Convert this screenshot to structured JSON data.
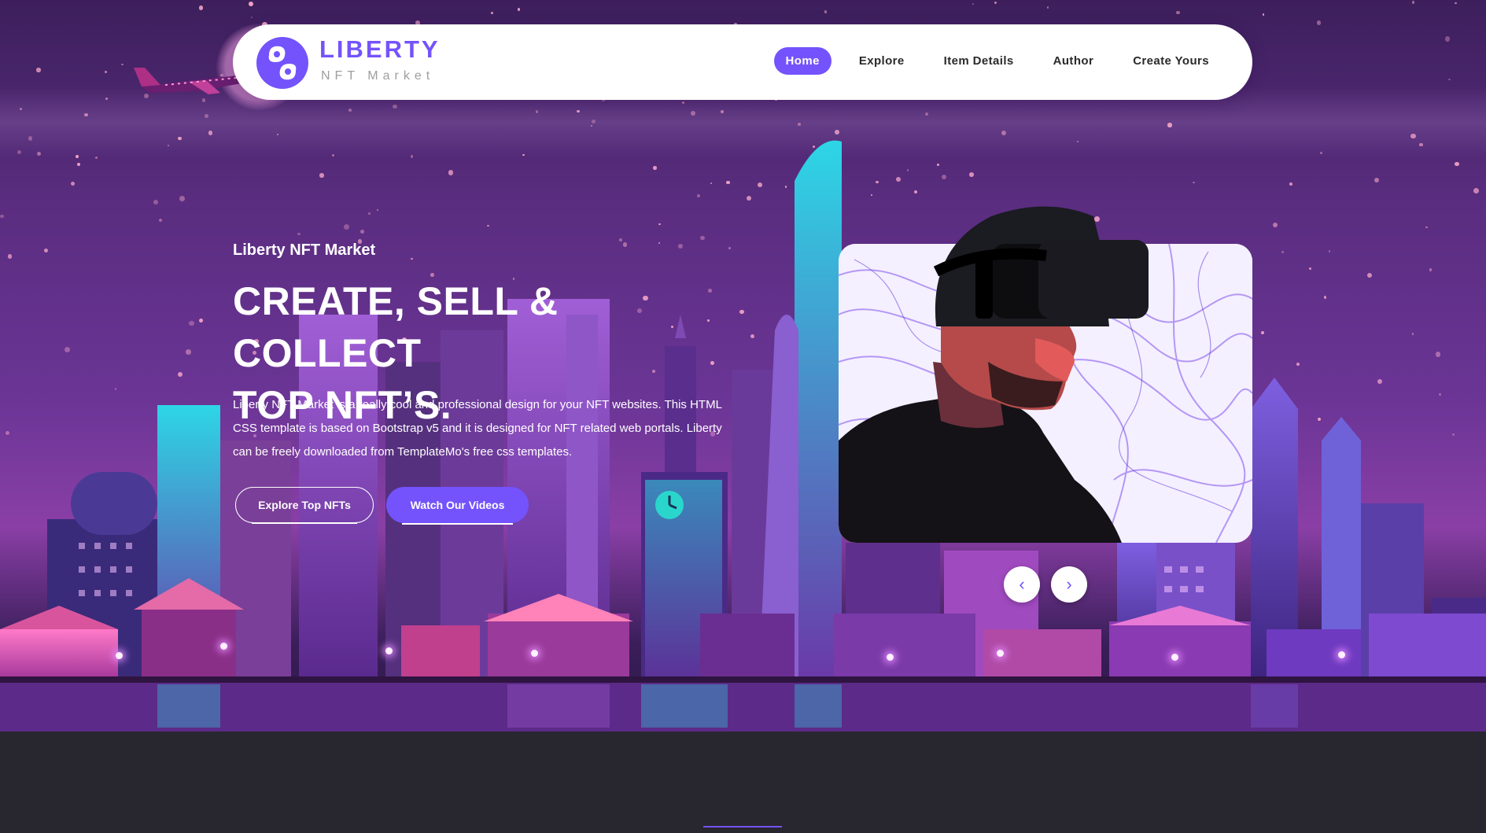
{
  "brand": {
    "title": "LIBERTY",
    "subtitle": "NFT Market",
    "accent": "#7453fc"
  },
  "nav": {
    "items": [
      {
        "label": "Home",
        "active": true
      },
      {
        "label": "Explore",
        "active": false
      },
      {
        "label": "Item Details",
        "active": false
      },
      {
        "label": "Author",
        "active": false
      },
      {
        "label": "Create Yours",
        "active": false
      }
    ]
  },
  "hero": {
    "kicker": "Liberty NFT Market",
    "headline_line1": "CREATE, SELL & COLLECT",
    "headline_line2": "TOP NFT’S.",
    "description": "Liberty NFT Market is a really cool and professional design for your NFT websites. This HTML CSS template is based on Bootstrap v5 and it is designed for NFT related web portals. Liberty can be freely downloaded from TemplateMo's free css templates.",
    "button_explore": "Explore Top NFTs",
    "button_videos": "Watch Our Videos"
  },
  "slider": {
    "prev_icon": "‹",
    "next_icon": "›",
    "image": "vr-headset-man-icon"
  }
}
